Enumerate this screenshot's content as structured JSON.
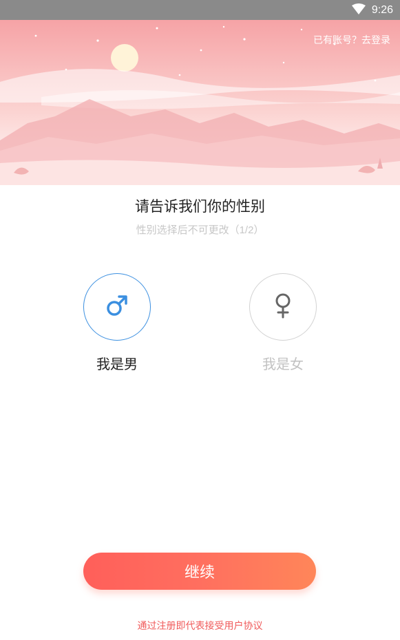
{
  "status_bar": {
    "time": "9:26",
    "wifi_icon": "wifi-icon"
  },
  "header": {
    "login_link": "已有账号？去登录"
  },
  "main": {
    "title": "请告诉我们你的性别",
    "subtitle": "性别选择后不可更改（1/2）",
    "options": [
      {
        "label": "我是男",
        "icon": "male-symbol-icon",
        "selected": true,
        "color": "#3b8fe0"
      },
      {
        "label": "我是女",
        "icon": "female-symbol-icon",
        "selected": false,
        "color": "#666666"
      }
    ]
  },
  "footer": {
    "continue_label": "继续",
    "agreement_text": "通过注册即代表接受用户协议"
  },
  "colors": {
    "accent_start": "#ff5f5a",
    "accent_end": "#ff8659",
    "male_blue": "#3b8fe0",
    "agreement_red": "#f05a5a"
  }
}
